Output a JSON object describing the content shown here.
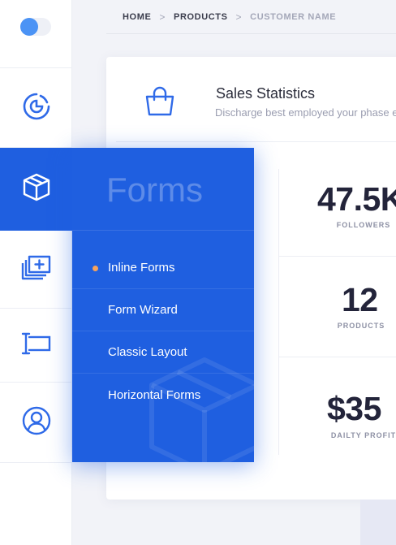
{
  "sidebar": {
    "items": [
      {
        "icon": "chart-pie-icon"
      },
      {
        "icon": "box-icon",
        "active": true
      },
      {
        "icon": "image-add-icon"
      },
      {
        "icon": "text-input-icon"
      },
      {
        "icon": "user-icon"
      }
    ]
  },
  "breadcrumb": {
    "items": [
      "HOME",
      "PRODUCTS",
      "CUSTOMER NAME"
    ],
    "separator": ">"
  },
  "card": {
    "icon": "shopping-bag-icon",
    "title": "Sales Statistics",
    "subtitle": "Discharge best employed your phase e"
  },
  "stats": [
    {
      "value": "47.5K",
      "label": "FOLLOWERS"
    },
    {
      "value": "12",
      "label": "PRODUCTS"
    },
    {
      "value": "$35",
      "label": "DAILTY PROFIT"
    }
  ],
  "flyout": {
    "title": "Forms",
    "items": [
      {
        "label": "Inline Forms",
        "active": true
      },
      {
        "label": "Form Wizard"
      },
      {
        "label": "Classic Layout"
      },
      {
        "label": "Horizontal Forms"
      }
    ]
  },
  "colors": {
    "accent": "#1f5fe0",
    "icon_blue": "#2f6ae8",
    "active_dot": "#f7a35c",
    "background": "#f2f3f8"
  }
}
